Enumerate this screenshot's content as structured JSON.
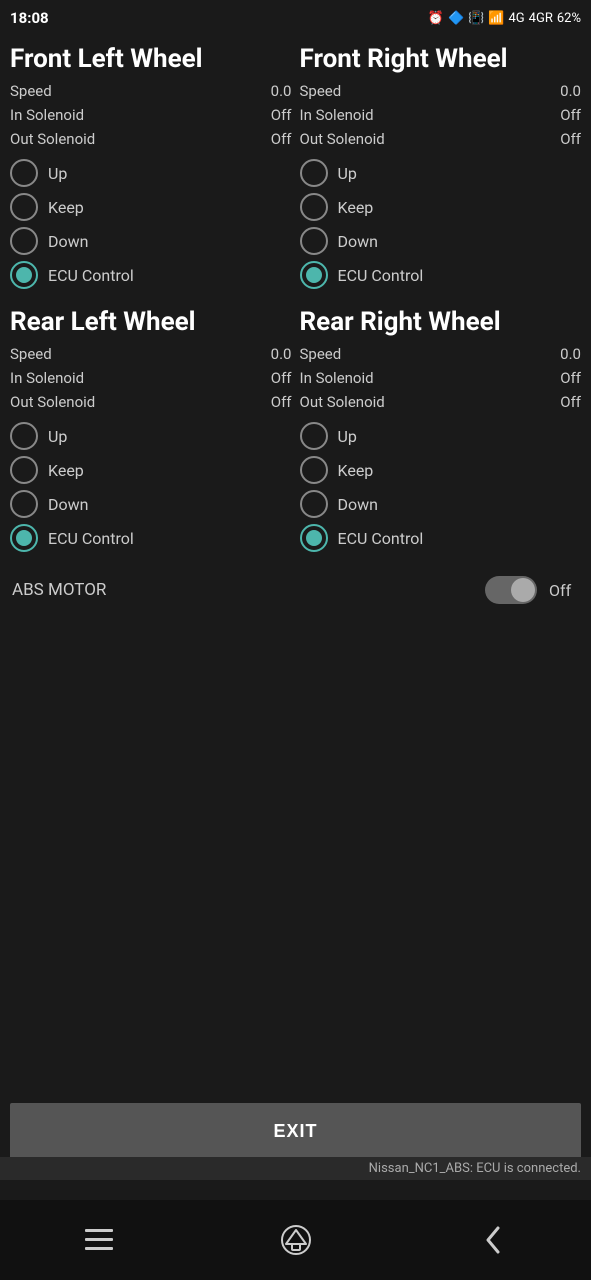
{
  "status_bar": {
    "time": "18:08",
    "battery": "62"
  },
  "wheels": {
    "front_left": {
      "title": "Front Left Wheel",
      "speed_label": "Speed",
      "speed_value": "0.0",
      "in_solenoid_label": "In Solenoid",
      "in_solenoid_value": "Off",
      "out_solenoid_label": "Out Solenoid",
      "out_solenoid_value": "Off",
      "options": [
        "Up",
        "Keep",
        "Down",
        "ECU Control"
      ],
      "selected": 3
    },
    "front_right": {
      "title": "Front Right Wheel",
      "speed_label": "Speed",
      "speed_value": "0.0",
      "in_solenoid_label": "In Solenoid",
      "in_solenoid_value": "Off",
      "out_solenoid_label": "Out Solenoid",
      "out_solenoid_value": "Off",
      "options": [
        "Up",
        "Keep",
        "Down",
        "ECU Control"
      ],
      "selected": 3
    },
    "rear_left": {
      "title": "Rear Left Wheel",
      "speed_label": "Speed",
      "speed_value": "0.0",
      "in_solenoid_label": "In Solenoid",
      "in_solenoid_value": "Off",
      "out_solenoid_label": "Out Solenoid",
      "out_solenoid_value": "Off",
      "options": [
        "Up",
        "Keep",
        "Down",
        "ECU Control"
      ],
      "selected": 3
    },
    "rear_right": {
      "title": "Rear Right Wheel",
      "speed_label": "Speed",
      "speed_value": "0.0",
      "in_solenoid_label": "In Solenoid",
      "in_solenoid_value": "Off",
      "out_solenoid_label": "Out Solenoid",
      "out_solenoid_value": "Off",
      "options": [
        "Up",
        "Keep",
        "Down",
        "ECU Control"
      ],
      "selected": 3
    }
  },
  "abs_motor": {
    "label": "ABS MOTOR",
    "value": "Off",
    "enabled": false
  },
  "exit_button_label": "EXIT",
  "connection_status": "Nissan_NC1_ABS: ECU is connected.",
  "nav": {
    "menu_icon": "☰",
    "back_icon": "<"
  }
}
